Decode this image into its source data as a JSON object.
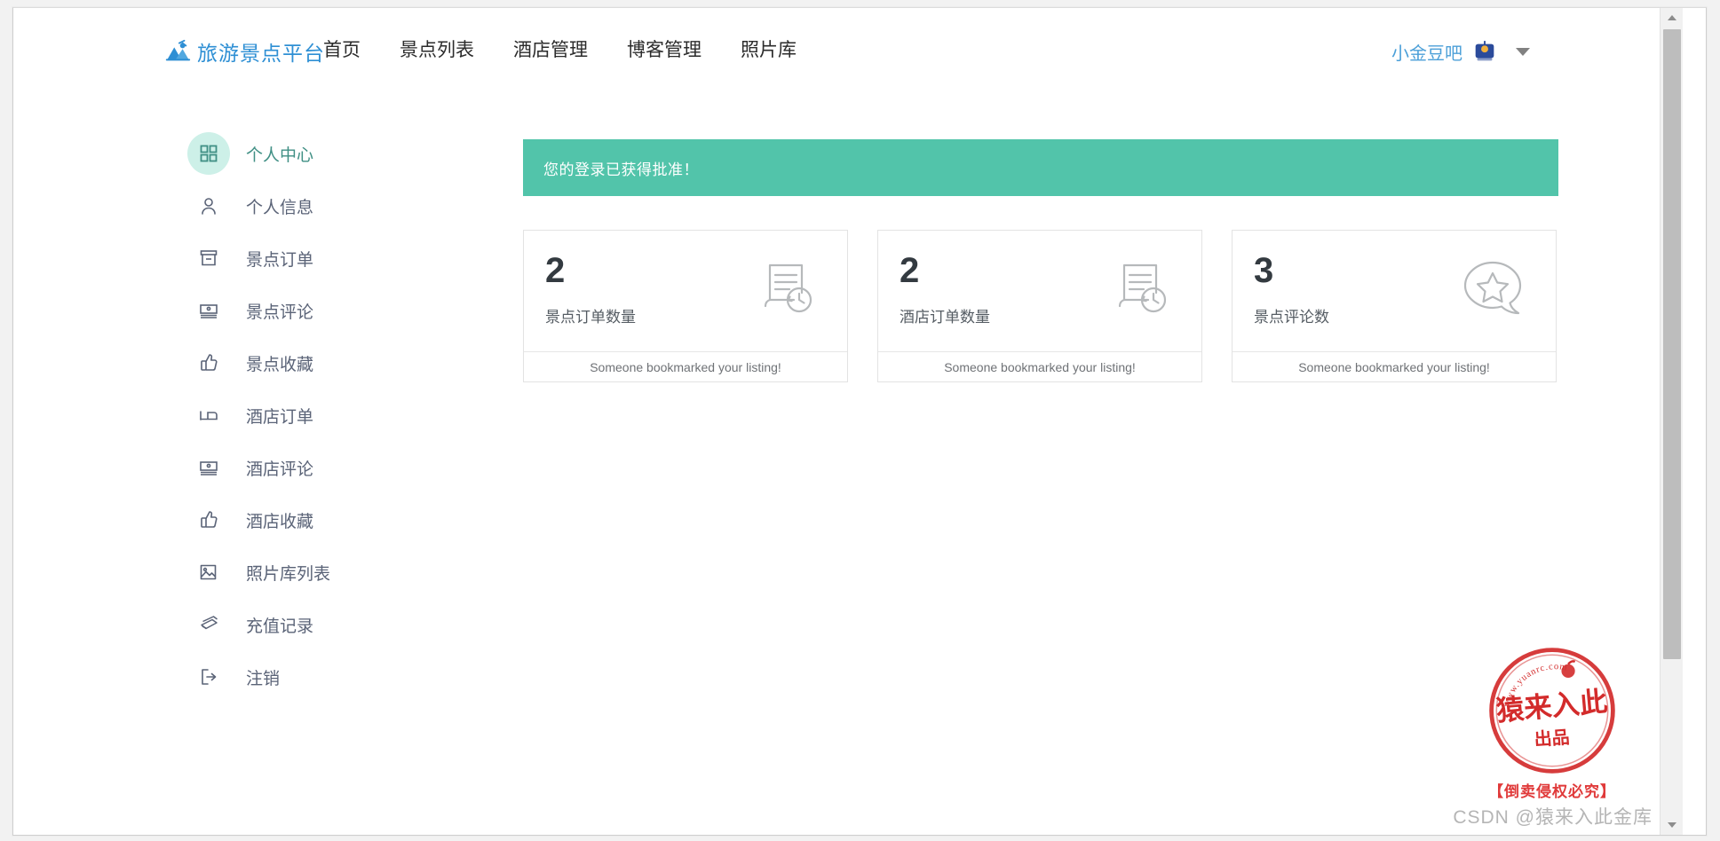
{
  "header": {
    "brand": "旅游景点平台",
    "brand_icon": "mountain-logo-icon",
    "brand_color": "#2e8fd4",
    "nav": [
      {
        "label": "首页",
        "name": "nav-home"
      },
      {
        "label": "景点列表",
        "name": "nav-attraction-list"
      },
      {
        "label": "酒店管理",
        "name": "nav-hotel-management"
      },
      {
        "label": "博客管理",
        "name": "nav-blog-management"
      },
      {
        "label": "照片库",
        "name": "nav-photo-gallery"
      }
    ],
    "user": {
      "name": "小金豆吧",
      "avatar_icon": "user-avatar-icon",
      "caret_icon": "chevron-down-icon"
    }
  },
  "sidebar": {
    "items": [
      {
        "label": "个人中心",
        "icon": "grid-icon",
        "active": true
      },
      {
        "label": "个人信息",
        "icon": "user-icon",
        "active": false
      },
      {
        "label": "景点订单",
        "icon": "archive-box-icon",
        "active": false
      },
      {
        "label": "景点评论",
        "icon": "comment-card-icon",
        "active": false
      },
      {
        "label": "景点收藏",
        "icon": "thumbs-up-icon",
        "active": false
      },
      {
        "label": "酒店订单",
        "icon": "bed-icon",
        "active": false
      },
      {
        "label": "酒店评论",
        "icon": "comment-card-icon",
        "active": false
      },
      {
        "label": "酒店收藏",
        "icon": "thumbs-up-icon",
        "active": false
      },
      {
        "label": "照片库列表",
        "icon": "photo-icon",
        "active": false
      },
      {
        "label": "充值记录",
        "icon": "credit-cards-icon",
        "active": false
      },
      {
        "label": "注销",
        "icon": "logout-icon",
        "active": false
      }
    ],
    "active_bg": "#cdf0e8",
    "active_text": "#3f8f84",
    "text_color": "#5a6377"
  },
  "main": {
    "alert": {
      "text": "您的登录已获得批准！",
      "bg": "#52c4aa",
      "text_color": "#ffffff"
    },
    "cards": [
      {
        "value": "2",
        "label": "景点订单数量",
        "footer": "Someone bookmarked your listing!",
        "icon": "document-history-icon"
      },
      {
        "value": "2",
        "label": "酒店订单数量",
        "footer": "Someone bookmarked your listing!",
        "icon": "document-history-icon"
      },
      {
        "value": "3",
        "label": "景点评论数",
        "footer": "Someone bookmarked your listing!",
        "icon": "star-comment-icon"
      }
    ]
  },
  "watermark": {
    "stamp_site": "www.yuanrc.com",
    "stamp_main": "猿来入此",
    "stamp_sub": "出品",
    "warning": "【倒卖侵权必究】",
    "credit": "CSDN @猿来入此金库",
    "stamp_color": "#d32b2b"
  },
  "scrollbar": {
    "up_icon": "scroll-up-arrow-icon",
    "down_icon": "scroll-down-arrow-icon",
    "thumb": "scroll-thumb"
  }
}
